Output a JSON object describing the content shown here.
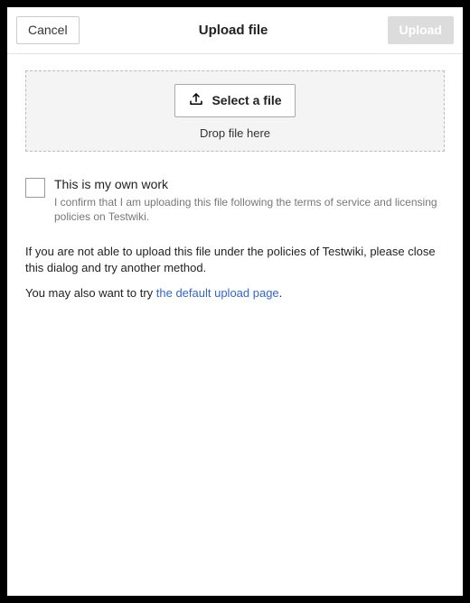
{
  "header": {
    "cancel_label": "Cancel",
    "title": "Upload file",
    "upload_label": "Upload"
  },
  "dropzone": {
    "select_label": "Select a file",
    "hint": "Drop file here"
  },
  "own_work": {
    "title": "This is my own work",
    "description": "I confirm that I am uploading this file following the terms of service and licensing policies on Testwiki."
  },
  "policy_text": "If you are not able to upload this file under the policies of Testwiki, please close this dialog and try another method.",
  "alt_prefix": "You may also want to try ",
  "alt_link": "the default upload page",
  "alt_suffix": "."
}
